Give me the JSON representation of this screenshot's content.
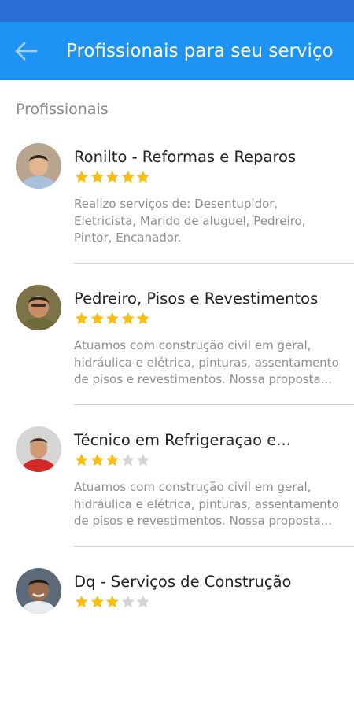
{
  "app_bar": {
    "back_icon": "arrow-left-icon",
    "title": "Profissionais para seu serviço"
  },
  "section": {
    "title": "Profissionais"
  },
  "colors": {
    "status_bar": "#2a70d4",
    "app_bar": "#1d94f4",
    "star_filled": "#f9be12",
    "star_empty": "#d4d4d4"
  },
  "professionals": [
    {
      "name": "Ronilto - Reformas e Reparos",
      "rating": 5,
      "description": "Realizo serviços de: Desentupidor, Eletricista, Marido de aluguel, Pedreiro, Pintor, Encanador."
    },
    {
      "name": "Pedreiro, Pisos e Revestimentos",
      "rating": 5,
      "description": "Atuamos com construção civil em geral, hidráulica e elétrica, pinturas, assentamento de pisos e revestimentos. Nossa proposta..."
    },
    {
      "name": "Técnico em Refrigeraçao e...",
      "rating": 3,
      "description": "Atuamos com construção civil em geral, hidráulica e elétrica, pinturas, assentamento de pisos e revestimentos. Nossa proposta..."
    },
    {
      "name": "Dq - Serviços de Construção",
      "rating": 3,
      "description": ""
    }
  ]
}
